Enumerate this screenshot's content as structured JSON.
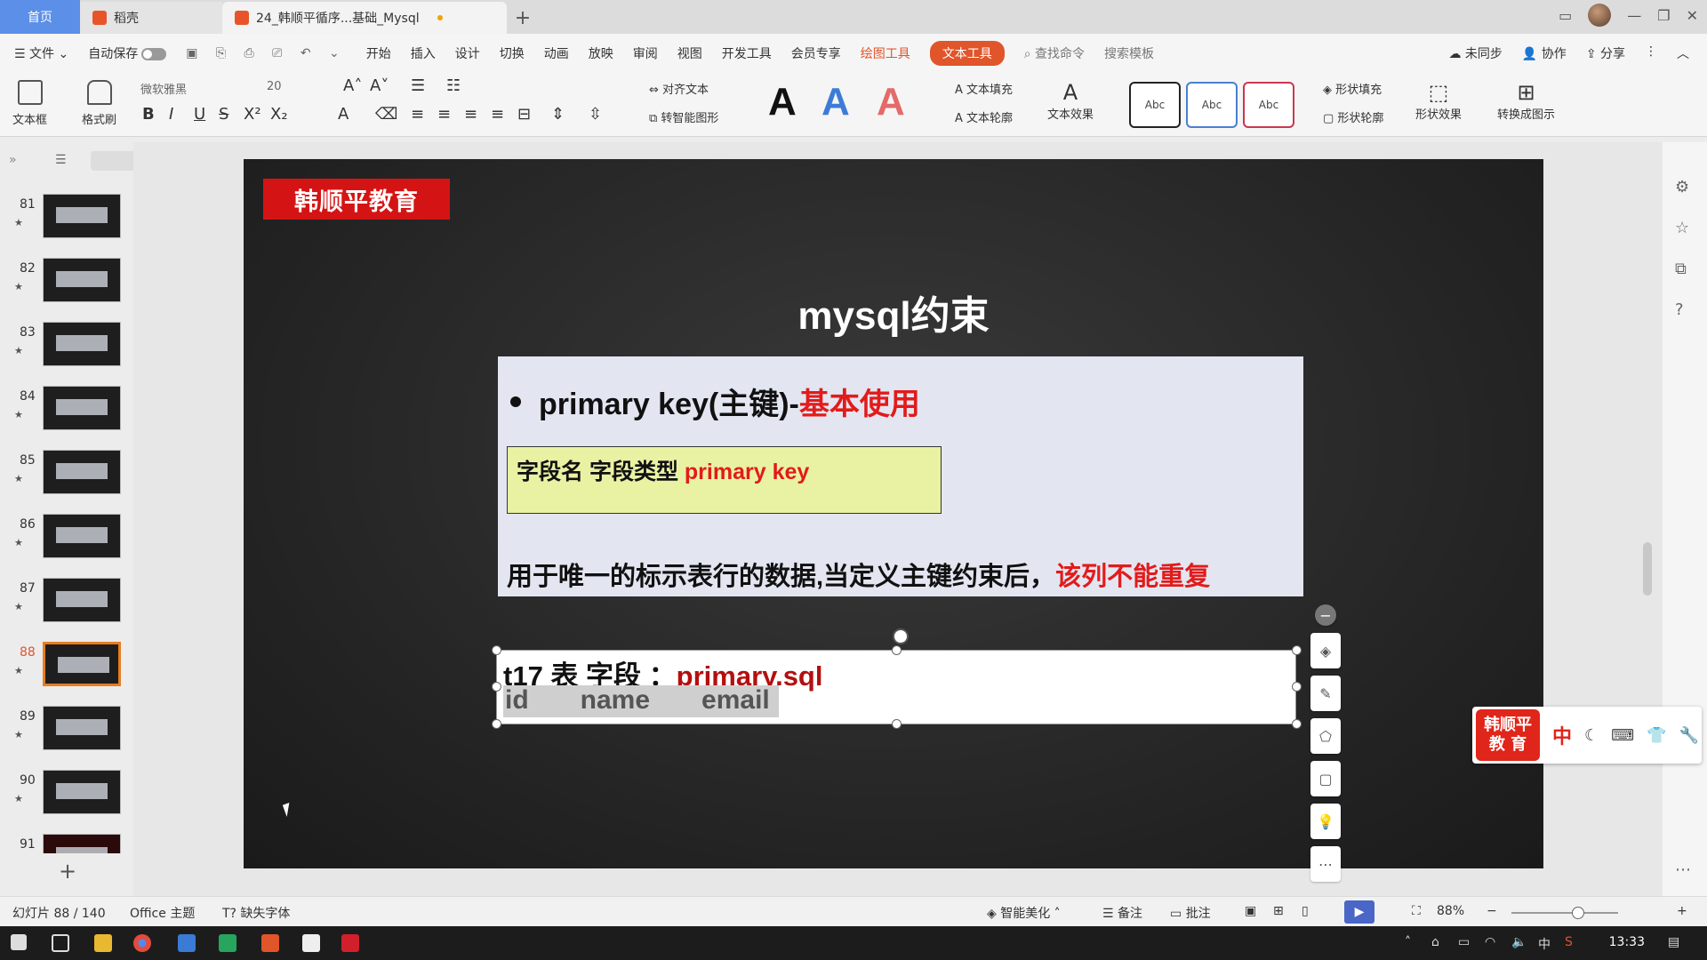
{
  "tabs": {
    "home": "首页",
    "daoke": "稻壳",
    "doc": "24_韩顺平循序...基础_Mysql"
  },
  "menu": {
    "file": "文件",
    "autosave": "自动保存",
    "items": [
      "开始",
      "插入",
      "设计",
      "切换",
      "动画",
      "放映",
      "审阅",
      "视图",
      "开发工具",
      "会员专享"
    ],
    "drawing_tools": "绘图工具",
    "text_tools": "文本工具",
    "search_cmd": "查找命令",
    "search_template": "搜索模板",
    "unsynced": "未同步",
    "collab": "协作",
    "share": "分享"
  },
  "ribbon": {
    "textbox": "文本框",
    "format_painter": "格式刷",
    "font_name": "微软雅黑",
    "font_size": "20",
    "align_text": "对齐文本",
    "to_smartart": "转智能图形",
    "text_fill": "文本填充",
    "text_outline": "文本轮廓",
    "text_effect": "文本效果",
    "style_abc": [
      "Abc",
      "Abc",
      "Abc"
    ],
    "shape_fill": "形状填充",
    "shape_outline": "形状轮廓",
    "shape_effect": "形状效果",
    "convert_to_diagram": "转换成图示"
  },
  "thumbnails": [
    {
      "num": "81"
    },
    {
      "num": "82"
    },
    {
      "num": "83"
    },
    {
      "num": "84"
    },
    {
      "num": "85"
    },
    {
      "num": "86"
    },
    {
      "num": "87"
    },
    {
      "num": "88"
    },
    {
      "num": "89"
    },
    {
      "num": "90"
    },
    {
      "num": "91"
    }
  ],
  "slide": {
    "brand": "韩顺平教育",
    "title": "mysql约束",
    "bullet_prefix": "primary key(主键)-",
    "bullet_highlight": "基本使用",
    "syntax_prefix": "字段名 字段类型 ",
    "syntax_keyword": "primary key",
    "desc_prefix": "用于唯一的标示表行的数据,当定义主键约束后，",
    "desc_highlight": "该列不能重复",
    "table_label": "t17 表 字段 ：",
    "table_file": "primary.sql",
    "fields": [
      "id",
      "name",
      "email"
    ]
  },
  "ime": {
    "logo_line1": "韩顺平",
    "logo_line2": "教 育",
    "mode": "中"
  },
  "status": {
    "slide_count": "幻灯片 88 / 140",
    "theme": "Office 主题",
    "missing_font": "缺失字体",
    "beautify": "智能美化",
    "notes": "备注",
    "comments": "批注",
    "zoom": "88%"
  },
  "taskbar": {
    "clock": "13:33",
    "lang": "中"
  },
  "colors": {
    "accent_orange": "#e0552a",
    "brand_red": "#d41414",
    "highlight_red": "#e21b1b"
  }
}
